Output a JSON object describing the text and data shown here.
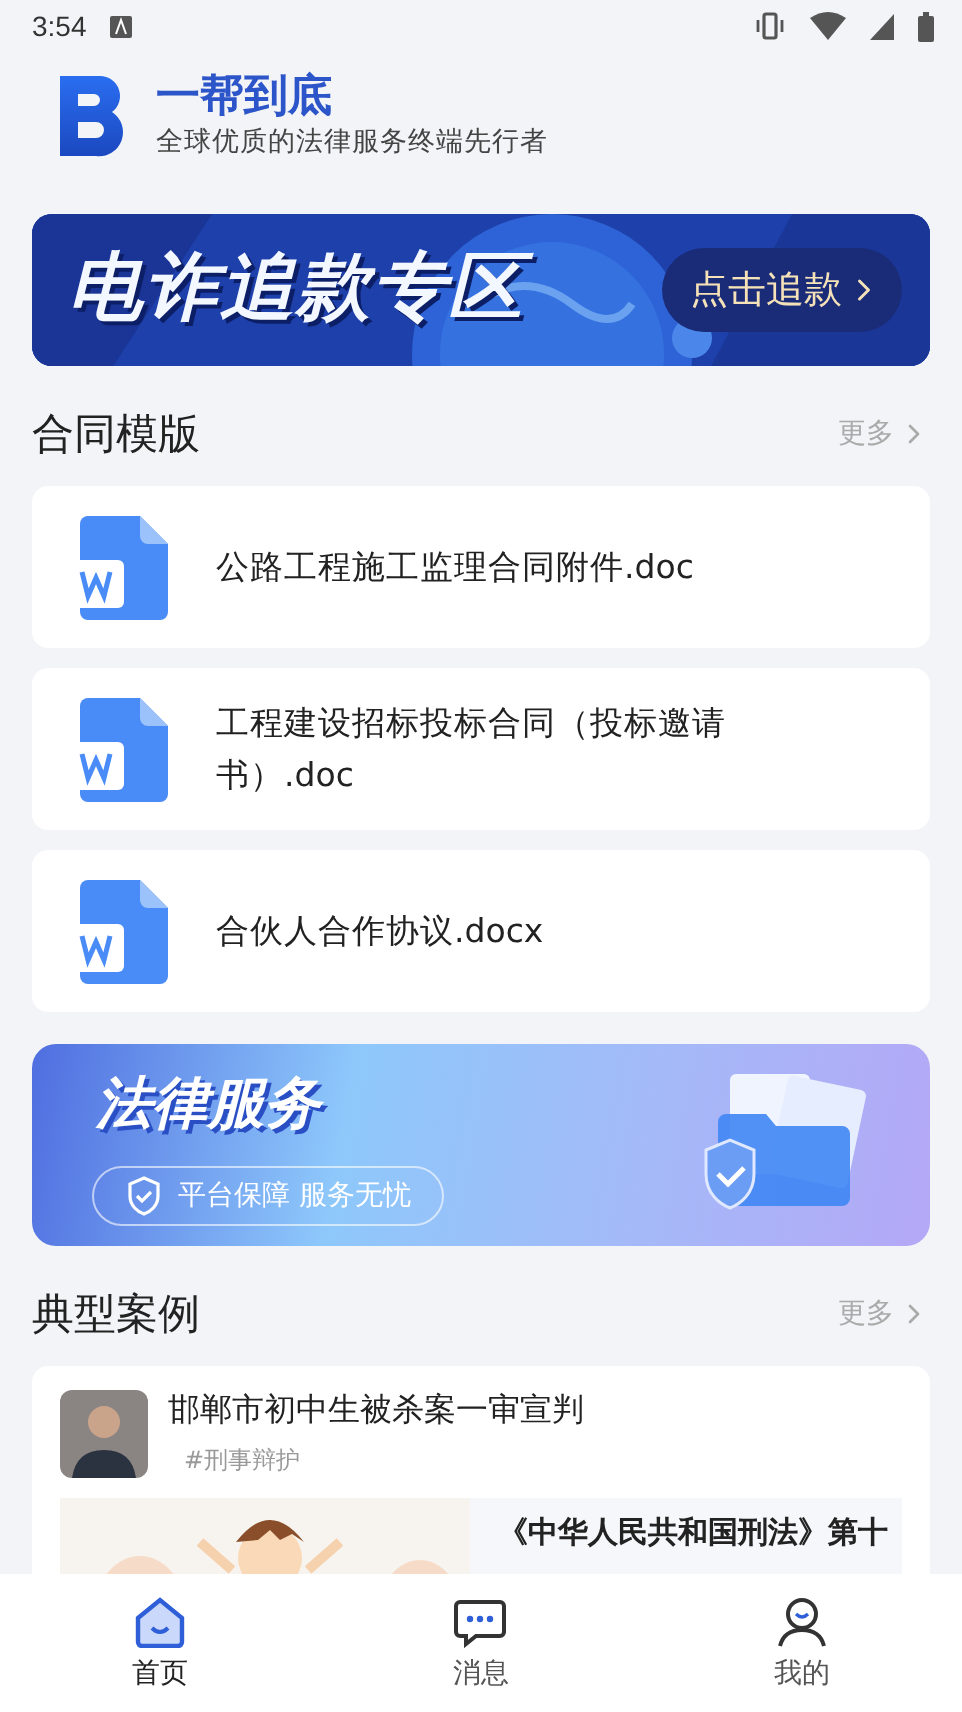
{
  "status_bar": {
    "time": "3:54"
  },
  "header": {
    "title": "一帮到底",
    "subtitle": "全球优质的法律服务终端先行者"
  },
  "fraud_banner": {
    "title": "电诈追款专区",
    "button": "点击追款"
  },
  "contracts": {
    "title": "合同模版",
    "more": "更多",
    "items": [
      {
        "name": "公路工程施工监理合同附件.doc"
      },
      {
        "name": "工程建设招标投标合同（投标邀请书）.doc"
      },
      {
        "name": "合伙人合作协议.docx"
      }
    ]
  },
  "legal_banner": {
    "title": "法律服务",
    "tagline": "平台保障 服务无忧"
  },
  "cases": {
    "title": "典型案例",
    "more": "更多",
    "items": [
      {
        "title": "邯郸市初中生被杀案一审宣判",
        "tag": "#刑事辩护",
        "excerpt": "《中华人民共和国刑法》第十"
      }
    ]
  },
  "tab_bar": [
    {
      "label": "首页",
      "selected": true,
      "kind": "home"
    },
    {
      "label": "消息",
      "selected": false,
      "kind": "message"
    },
    {
      "label": "我的",
      "selected": false,
      "kind": "profile"
    }
  ]
}
